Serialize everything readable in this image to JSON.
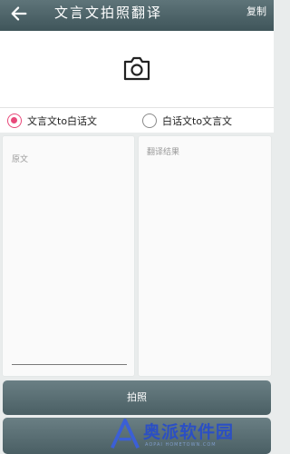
{
  "appbar": {
    "title": "文言文拍照翻译",
    "copy_label": "复制"
  },
  "mode": {
    "option_classical_to_modern": {
      "label": "文言文to白话文",
      "checked": true
    },
    "option_modern_to_classical": {
      "label": "白话文to文言文",
      "checked": false
    }
  },
  "source_panel": {
    "placeholder": "原文"
  },
  "result_panel": {
    "placeholder": "翻译结果"
  },
  "buttons": {
    "shoot_label": "拍照"
  },
  "watermark": {
    "text": "奥派软件园",
    "sub": "AOPAI HOMETOWN.COM"
  },
  "colors": {
    "appbar": "#4f6569",
    "accent": "#e8497a",
    "button": "#56696e"
  },
  "icons": {
    "back": "arrow-left-icon",
    "camera": "camera-icon"
  }
}
